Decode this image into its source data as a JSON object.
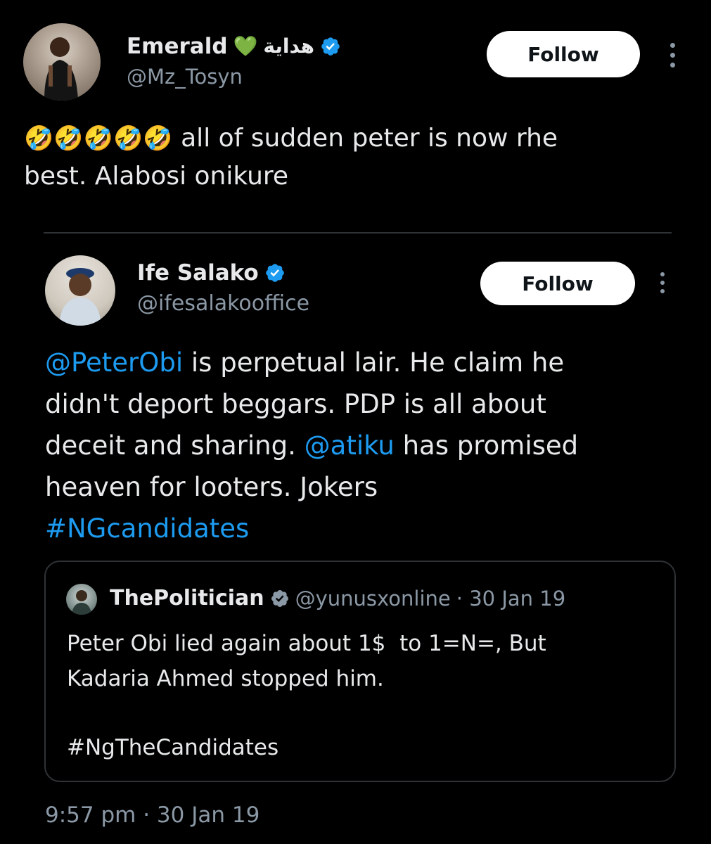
{
  "main_tweet": {
    "display_name": "Emerald",
    "name_emoji": "💚",
    "name_arabic": "هداية",
    "handle": "@Mz_Tosyn",
    "follow_label": "Follow",
    "emojis": "🤣🤣🤣🤣🤣",
    "text_line1": "all of sudden peter is now rhe",
    "text_line2": "best. Alabosi onikure",
    "timestamp": "9:57 pm · 30 Jan 19"
  },
  "embedded_tweet": {
    "display_name": "Ife Salako",
    "handle": "@ifesalakooffice",
    "follow_label": "Follow",
    "body_mention1": "@PeterObi",
    "body_line1_rest": " is perpetual lair. He claim he",
    "body_line2": "didn't deport beggars. PDP is all about",
    "body_line3_pre": "deceit and sharing. ",
    "body_mention2": "@atiku",
    "body_line3_post": " has promised",
    "body_line4": "heaven for looters. Jokers",
    "hashtag": "#NGcandidates"
  },
  "quoted_tweet": {
    "display_name": "ThePolitician",
    "handle": "@yunusxonline",
    "date": "· 30 Jan 19",
    "line1": "Peter Obi lied again about 1$  to 1=N=, But",
    "line2": "Kadaria Ahmed stopped him.",
    "hashtag": "#NgTheCandidates"
  },
  "colors": {
    "background": "#000000",
    "text": "#e7e9ea",
    "secondary": "#8b98a5",
    "link": "#1d9bf0",
    "verified_blue": "#1d9bf0",
    "verified_grey": "#8b98a5"
  },
  "icons": {
    "verified": "verified-badge-icon",
    "more": "more-vertical-icon"
  }
}
